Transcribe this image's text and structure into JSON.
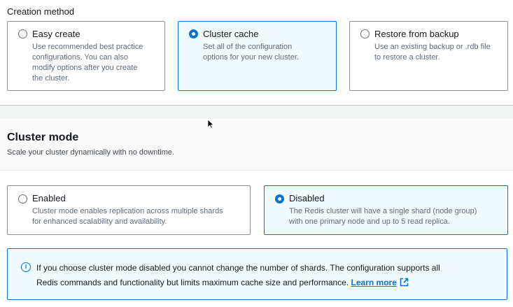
{
  "creation_method": {
    "label": "Creation method",
    "options": [
      {
        "title": "Easy create",
        "desc_lines": [
          "Use recommended best practice",
          "configurations. You can also",
          "modify options after you create",
          "the cluster."
        ],
        "selected": false
      },
      {
        "title": "Cluster cache",
        "desc_lines": [
          "Set all of the configuration",
          "options for your new cluster."
        ],
        "selected": true
      },
      {
        "title": "Restore from backup",
        "desc_lines": [
          "Use an existing backup or .rdb file",
          "to restore a cluster."
        ],
        "selected": false
      }
    ]
  },
  "cluster_mode": {
    "title": "Cluster mode",
    "subtitle": "Scale your cluster dynamically with no downtime.",
    "options": [
      {
        "title": "Enabled",
        "desc_lines": [
          "Cluster mode enables replication across multiple shards",
          "for enhanced scalability and availability."
        ],
        "selected": false
      },
      {
        "title": "Disabled",
        "desc_lines": [
          "The Redis cluster will have a single shard (node group)",
          "with one primary node and up to 5 read replica."
        ],
        "selected": true
      }
    ]
  },
  "info_alert": {
    "icon": "info-icon",
    "line1": "If you choose cluster mode disabled you cannot change the number of shards. The configuration supports all",
    "line2": "Redis commands and functionality but limits maximum cache size and performance.",
    "link_label": "Learn more",
    "link_icon": "external-link-icon"
  },
  "colors": {
    "accent": "#0972d3",
    "selected_bg": "#f1faff",
    "border": "#8d9096"
  }
}
